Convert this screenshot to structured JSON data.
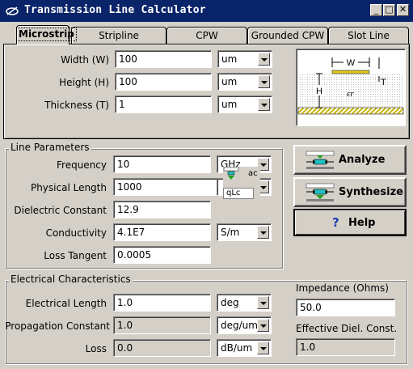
{
  "window": {
    "title": "Transmission Line Calculator",
    "buttons": {
      "minimize": "_",
      "maximize": "□",
      "close": "✕"
    }
  },
  "tabs": [
    {
      "label": "Microstrip"
    },
    {
      "label": "Stripline"
    },
    {
      "label": "CPW"
    },
    {
      "label": "Grounded CPW"
    },
    {
      "label": "Slot Line"
    }
  ],
  "geometry": {
    "width": {
      "label": "Width (W)",
      "value": "100",
      "unit": "um"
    },
    "height": {
      "label": "Height (H)",
      "value": "100",
      "unit": "um"
    },
    "thickness": {
      "label": "Thickness (T)",
      "value": "1",
      "unit": "um"
    },
    "diagram": {
      "w": "W",
      "h": "H",
      "t": "T",
      "er": "εr"
    }
  },
  "line_parameters": {
    "legend": "Line Parameters",
    "frequency": {
      "label": "Frequency",
      "value": "10",
      "unit": "GHz"
    },
    "physical_length": {
      "label": "Physical Length",
      "value": "1000"
    },
    "dielectric_constant": {
      "label": "Dielectric Constant",
      "value": "12.9"
    },
    "conductivity": {
      "label": "Conductivity",
      "value": "4.1E7",
      "unit": "S/m"
    },
    "loss_tangent": {
      "label": "Loss Tangent",
      "value": "0.0005"
    },
    "tooltip_fragments": {
      "a": "ac",
      "b": "qLc"
    }
  },
  "actions": {
    "analyze": "Analyze",
    "synthesize": "Synthesize",
    "help": "Help"
  },
  "electrical": {
    "legend": "Electrical Characteristics",
    "electrical_length": {
      "label": "Electrical Length",
      "value": "1.0",
      "unit": "deg"
    },
    "propagation_constant": {
      "label": "Propagation Constant",
      "value": "1.0",
      "unit": "deg/um"
    },
    "loss": {
      "label": "Loss",
      "value": "0.0",
      "unit": "dB/um"
    },
    "impedance": {
      "label": "Impedance (Ohms)",
      "value": "50.0"
    },
    "effective_diel": {
      "label": "Effective Diel. Const.",
      "value": "1.0"
    }
  },
  "colors": {
    "titlebar": "#0a246a",
    "face": "#d4d0c8",
    "substrate_hatch": "#d8c800",
    "conductor": "#e0c820"
  }
}
